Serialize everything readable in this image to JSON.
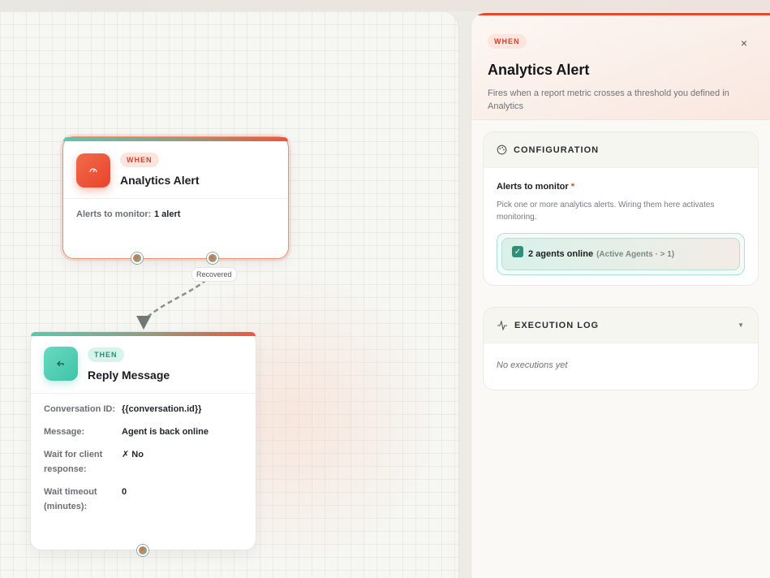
{
  "when_node": {
    "badge": "WHEN",
    "title": "Analytics Alert",
    "fields": [
      {
        "key": "Alerts to monitor:",
        "value": "1 alert"
      }
    ]
  },
  "edge": {
    "label": "Recovered"
  },
  "then_node": {
    "badge": "THEN",
    "title": "Reply Message",
    "fields": [
      {
        "key": "Conversation ID:",
        "value": "{{conversation.id}}"
      },
      {
        "key": "Message:",
        "value": "Agent is back online"
      },
      {
        "key": "Wait for client response:",
        "value": "✗ No"
      },
      {
        "key": "Wait timeout (minutes):",
        "value": "0"
      }
    ]
  },
  "panel": {
    "badge": "WHEN",
    "title": "Analytics Alert",
    "description": "Fires when a report metric crosses a threshold you defined in Analytics",
    "close": "×",
    "config": {
      "heading": "CONFIGURATION",
      "field_label": "Alerts to monitor",
      "required_mark": "*",
      "help": "Pick one or more analytics alerts. Wiring them here activates monitoring.",
      "selected": {
        "name": "2 agents online",
        "detail": "(Active Agents · > 1)",
        "checked": true
      }
    },
    "log": {
      "heading": "EXECUTION LOG",
      "empty": "No executions yet"
    }
  },
  "colors": {
    "accent": "#e2492f",
    "teal": "#3fc3a6"
  }
}
